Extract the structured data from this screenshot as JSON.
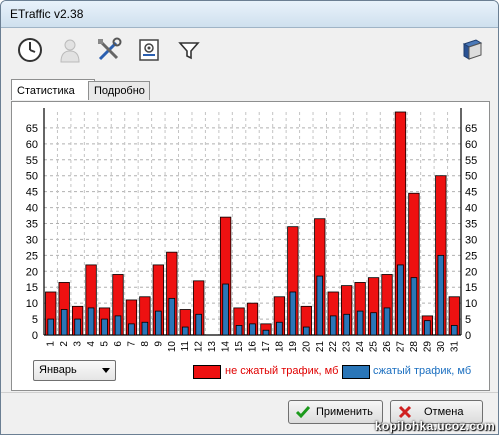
{
  "window": {
    "title": "ETraffic  v2.38"
  },
  "toolbar": {
    "icons": [
      "clock-icon",
      "user-icon",
      "tools-icon",
      "email-icon",
      "filter-icon",
      "book-icon"
    ]
  },
  "tabs": [
    {
      "label": "Статистика",
      "active": true
    },
    {
      "label": "Подробно",
      "active": false
    }
  ],
  "month_select": {
    "value": "Январь"
  },
  "legend": {
    "uncompressed": "не сжатый трафик, мб",
    "compressed": "сжатый трафик, мб"
  },
  "buttons": {
    "apply": "Применить",
    "cancel": "Отмена"
  },
  "watermark": "kopilohka.ucoz.com",
  "colors": {
    "uncompressed": "#ee1111",
    "compressed": "#2a76b8",
    "legend_text_uncompressed": "#e00000",
    "legend_text_compressed": "#1b6fc0"
  },
  "chart_data": {
    "type": "bar",
    "categories": [
      "1",
      "2",
      "3",
      "4",
      "5",
      "6",
      "7",
      "8",
      "9",
      "10",
      "11",
      "12",
      "13",
      "14",
      "15",
      "16",
      "17",
      "18",
      "19",
      "20",
      "21",
      "22",
      "23",
      "24",
      "25",
      "26",
      "27",
      "28",
      "29",
      "30",
      "31"
    ],
    "series": [
      {
        "name": "не сжатый трафик, мб",
        "values": [
          13.5,
          16.5,
          9,
          22,
          8.5,
          19,
          11,
          12,
          22,
          26,
          8,
          17,
          0,
          37,
          8.5,
          10,
          3.5,
          12,
          34,
          9,
          36.5,
          13.5,
          15.5,
          16.5,
          18,
          19,
          70,
          44.5,
          6,
          50,
          12
        ]
      },
      {
        "name": "сжатый трафик, мб",
        "values": [
          5,
          8,
          5,
          8.5,
          5,
          6,
          3.5,
          4,
          7.5,
          11.5,
          2.5,
          6.5,
          0,
          16,
          3,
          3.5,
          1.5,
          4,
          13.5,
          2.5,
          18.5,
          6,
          6.5,
          7.5,
          7,
          8.5,
          22,
          18,
          4.5,
          25,
          3
        ]
      }
    ],
    "yticks": [
      0,
      5,
      10,
      15,
      20,
      25,
      30,
      35,
      40,
      45,
      50,
      55,
      60,
      65
    ],
    "ylim": [
      0,
      70
    ],
    "grid": true,
    "legend_position": "bottom"
  }
}
